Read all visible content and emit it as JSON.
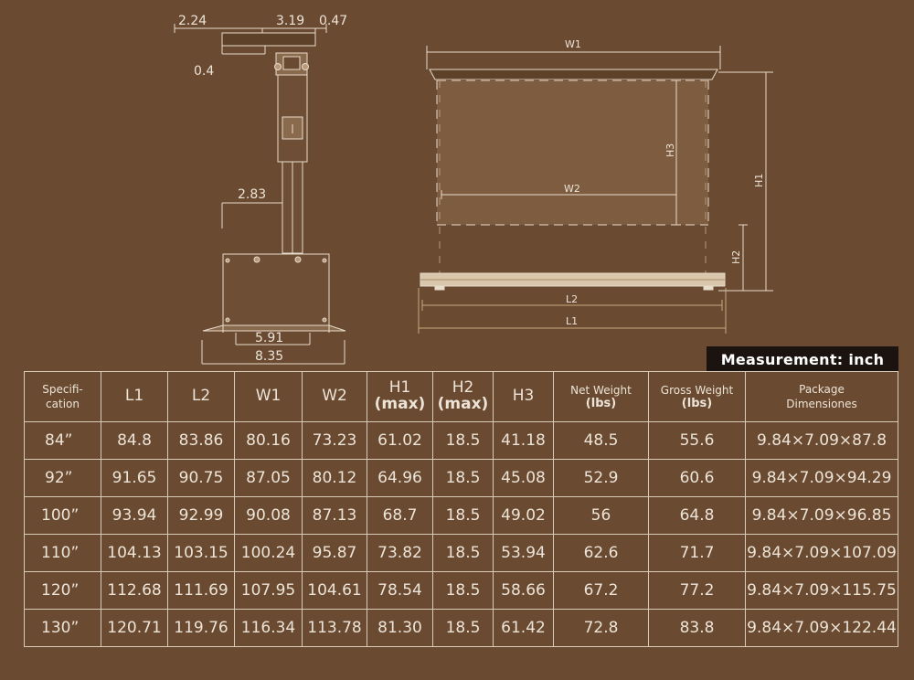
{
  "side_view": {
    "dims": [
      "2.24",
      "3.19",
      "0.47",
      "0.4",
      "2.83",
      "5.91",
      "8.35"
    ]
  },
  "front_view": {
    "labels": [
      "W1",
      "W2",
      "H3",
      "H1",
      "H2",
      "L2",
      "L1"
    ]
  },
  "measurement_badge": "Measurement: inch",
  "table": {
    "headers": [
      {
        "lines": [
          "Specifi-",
          "cation"
        ]
      },
      {
        "lines": [
          "L1"
        ]
      },
      {
        "lines": [
          "L2"
        ]
      },
      {
        "lines": [
          "W1"
        ]
      },
      {
        "lines": [
          "W2"
        ]
      },
      {
        "lines": [
          "H1",
          "(max)"
        ]
      },
      {
        "lines": [
          "H2",
          "(max)"
        ]
      },
      {
        "lines": [
          "H3"
        ]
      },
      {
        "lines": [
          "Net Weight",
          "(lbs)"
        ]
      },
      {
        "lines": [
          "Gross Weight",
          "(lbs)"
        ]
      },
      {
        "lines": [
          "Package",
          "Dimensiones"
        ]
      }
    ],
    "rows": [
      [
        "84”",
        "84.8",
        "83.86",
        "80.16",
        "73.23",
        "61.02",
        "18.5",
        "41.18",
        "48.5",
        "55.6",
        "9.84×7.09×87.8"
      ],
      [
        "92”",
        "91.65",
        "90.75",
        "87.05",
        "80.12",
        "64.96",
        "18.5",
        "45.08",
        "52.9",
        "60.6",
        "9.84×7.09×94.29"
      ],
      [
        "100”",
        "93.94",
        "92.99",
        "90.08",
        "87.13",
        "68.7",
        "18.5",
        "49.02",
        "56",
        "64.8",
        "9.84×7.09×96.85"
      ],
      [
        "110”",
        "104.13",
        "103.15",
        "100.24",
        "95.87",
        "73.82",
        "18.5",
        "53.94",
        "62.6",
        "71.7",
        "9.84×7.09×107.09"
      ],
      [
        "120”",
        "112.68",
        "111.69",
        "107.95",
        "104.61",
        "78.54",
        "18.5",
        "58.66",
        "67.2",
        "77.2",
        "9.84×7.09×115.75"
      ],
      [
        "130”",
        "120.71",
        "119.76",
        "116.34",
        "113.78",
        "81.30",
        "18.5",
        "61.42",
        "72.8",
        "83.8",
        "9.84×7.09×122.44"
      ]
    ]
  },
  "colors": {
    "background": "#6a4a30",
    "line": "#e8dccb",
    "screen_fill": "#8a6a4c",
    "frame_fill": "#5e4129",
    "badge_bg": "#1a1310"
  }
}
